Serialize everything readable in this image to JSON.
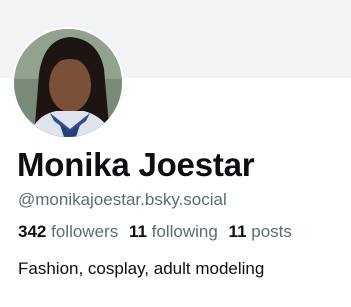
{
  "profile": {
    "display_name": "Monika Joestar",
    "handle": "@monikajoestar.bsky.social",
    "stats": {
      "followers_count": "342",
      "followers_label": "followers",
      "following_count": "11",
      "following_label": "following",
      "posts_count": "11",
      "posts_label": "posts"
    },
    "bio": "Fashion, cosplay, adult modeling"
  },
  "colors": {
    "banner": "#f1f3f5",
    "text_primary": "#0b0f14",
    "text_secondary": "#5b6b7c"
  }
}
